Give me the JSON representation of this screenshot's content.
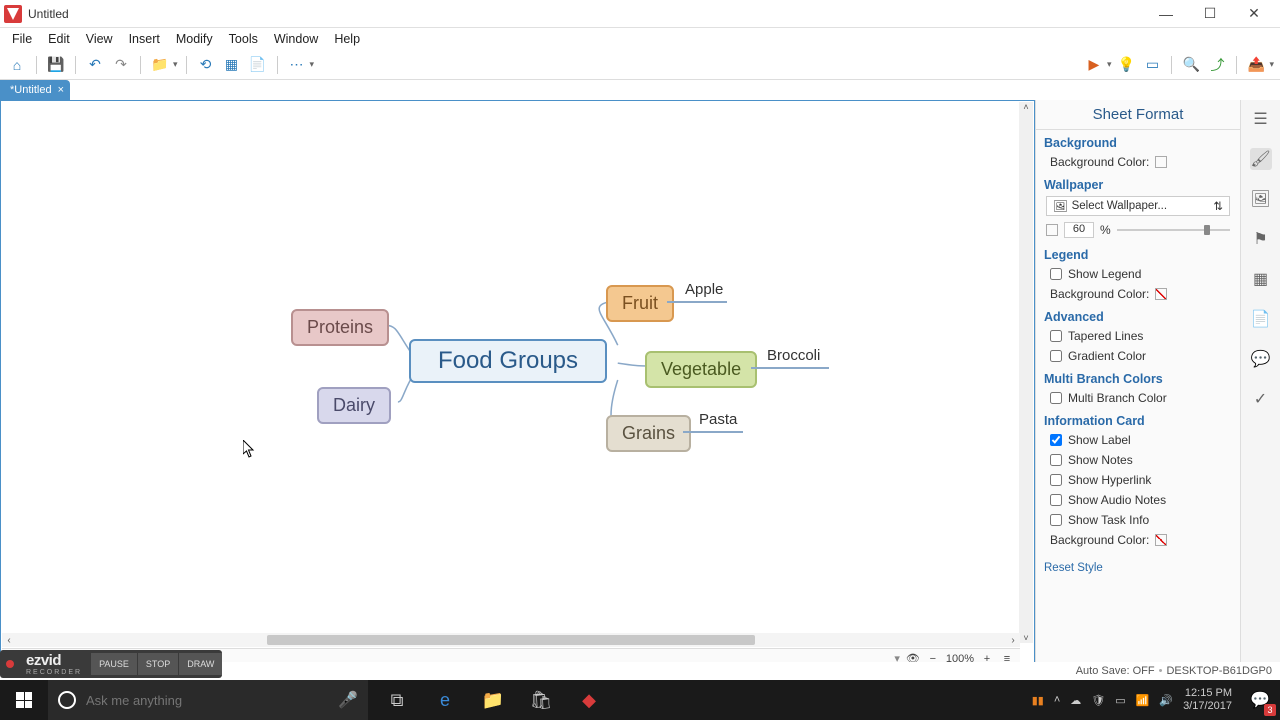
{
  "window": {
    "title": "Untitled"
  },
  "menu": {
    "file": "File",
    "edit": "Edit",
    "view": "View",
    "insert": "Insert",
    "modify": "Modify",
    "tools": "Tools",
    "window": "Window",
    "help": "Help"
  },
  "tab": {
    "name": "*Untitled"
  },
  "mindmap": {
    "central": "Food Groups",
    "proteins": "Proteins",
    "dairy": "Dairy",
    "fruit": "Fruit",
    "vegetable": "Vegetable",
    "grains": "Grains",
    "apple": "Apple",
    "broccoli": "Broccoli",
    "pasta": "Pasta"
  },
  "panel": {
    "title": "Sheet Format",
    "background_h": "Background",
    "bgcolor_label": "Background Color:",
    "wallpaper_h": "Wallpaper",
    "wallpaper_select": "Select Wallpaper...",
    "opacity_val": "60",
    "opacity_pct": "%",
    "legend_h": "Legend",
    "show_legend": "Show Legend",
    "legend_bgcolor": "Background Color:",
    "advanced_h": "Advanced",
    "tapered": "Tapered Lines",
    "gradient": "Gradient Color",
    "multibranch_h": "Multi Branch Colors",
    "multibranch": "Multi Branch Color",
    "infocard_h": "Information Card",
    "show_label": "Show Label",
    "show_notes": "Show Notes",
    "show_hyperlink": "Show Hyperlink",
    "show_audio": "Show Audio Notes",
    "show_task": "Show Task Info",
    "infocard_bgcolor": "Background Color:",
    "reset": "Reset Style"
  },
  "zoom": {
    "value": "100%"
  },
  "status": {
    "autosave": "Auto Save: OFF",
    "desktop": "DESKTOP-B61DGP0"
  },
  "recorder": {
    "brand": "ezvid",
    "sub": "RECORDER",
    "pause": "PAUSE",
    "stop": "STOP",
    "draw": "DRAW"
  },
  "taskbar": {
    "search_placeholder": "Ask me anything",
    "time": "12:15 PM",
    "date": "3/17/2017",
    "notif_count": "3"
  }
}
